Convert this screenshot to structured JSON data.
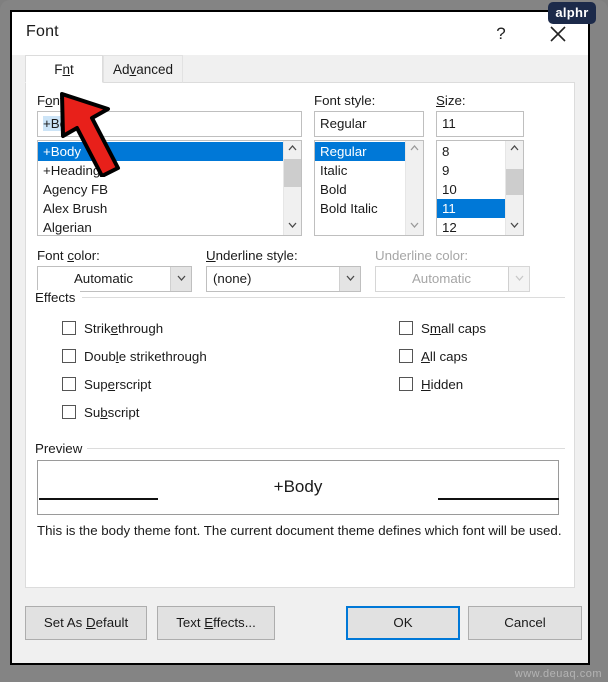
{
  "window": {
    "title": "Font",
    "help_icon": "question-mark-icon",
    "close_icon": "close-icon",
    "brand_badge": "alphr",
    "watermark": "www.deuaq.com"
  },
  "tabs": [
    {
      "label": "Font",
      "accel": "n",
      "active": true
    },
    {
      "label": "Advanced",
      "accel": "v",
      "active": false
    }
  ],
  "font_section": {
    "font_label_pre": "F",
    "font_label_accel": "o",
    "font_label_post": "nt:",
    "font_input_value": "+Body",
    "font_list": [
      {
        "label": "+Body",
        "selected": true
      },
      {
        "label": "+Headings",
        "selected": false
      },
      {
        "label": "Agency FB",
        "selected": false
      },
      {
        "label": "Alex Brush",
        "selected": false
      },
      {
        "label": "Algerian",
        "selected": false
      }
    ],
    "style_label": "Font style:",
    "style_input_value": "Regular",
    "style_list": [
      {
        "label": "Regular",
        "selected": true
      },
      {
        "label": "Italic",
        "selected": false
      },
      {
        "label": "Bold",
        "selected": false
      },
      {
        "label": "Bold Italic",
        "selected": false
      }
    ],
    "size_label_accel": "S",
    "size_label_post": "ize:",
    "size_input_value": "11",
    "size_list": [
      {
        "label": "8",
        "selected": false
      },
      {
        "label": "9",
        "selected": false
      },
      {
        "label": "10",
        "selected": false
      },
      {
        "label": "11",
        "selected": true
      },
      {
        "label": "12",
        "selected": false
      }
    ]
  },
  "color_row": {
    "font_color_label_pre": "Font ",
    "font_color_label_accel": "c",
    "font_color_label_post": "olor:",
    "font_color_value": "Automatic",
    "underline_style_label_accel": "U",
    "underline_style_label_post": "nderline style:",
    "underline_style_value": "(none)",
    "underline_color_label": "Underline color:",
    "underline_color_value": "Automatic",
    "underline_color_disabled": true
  },
  "effects": {
    "group_title": "Effects",
    "left_column": [
      {
        "label_pre": "Strik",
        "accel": "e",
        "label_post": "through",
        "checked": false
      },
      {
        "label_pre": "Doub",
        "accel": "l",
        "label_post": "e strikethrough",
        "checked": false
      },
      {
        "label_pre": "Sup",
        "accel": "e",
        "label_post": "rscript",
        "checked": false
      },
      {
        "label_pre": "Su",
        "accel": "b",
        "label_post": "script",
        "checked": false
      }
    ],
    "right_column": [
      {
        "label_pre": "S",
        "accel": "m",
        "label_post": "all caps",
        "checked": false
      },
      {
        "label_pre": "",
        "accel": "A",
        "label_post": "ll caps",
        "checked": false
      },
      {
        "label_pre": "",
        "accel": "H",
        "label_post": "idden",
        "checked": false
      }
    ]
  },
  "preview": {
    "group_title": "Preview",
    "sample_text": "+Body",
    "note": "This is the body theme font. The current document theme defines which font will be used."
  },
  "buttons": [
    {
      "label_pre": "Set As ",
      "accel": "D",
      "label_post": "efault",
      "default": false
    },
    {
      "label_pre": "Text ",
      "accel": "E",
      "label_post": "ffects...",
      "default": false
    },
    {
      "label_pre": "OK",
      "accel": "",
      "label_post": "",
      "default": true
    },
    {
      "label_pre": "Cancel",
      "accel": "",
      "label_post": "",
      "default": false
    }
  ],
  "colors": {
    "selection_blue": "#0078d7",
    "input_selection": "#cce4f7",
    "dialog_bg": "#f0f0f0",
    "panel_bg": "#ffffff",
    "pointer_red": "#e8201a",
    "badge_navy": "#1c2a4a"
  }
}
